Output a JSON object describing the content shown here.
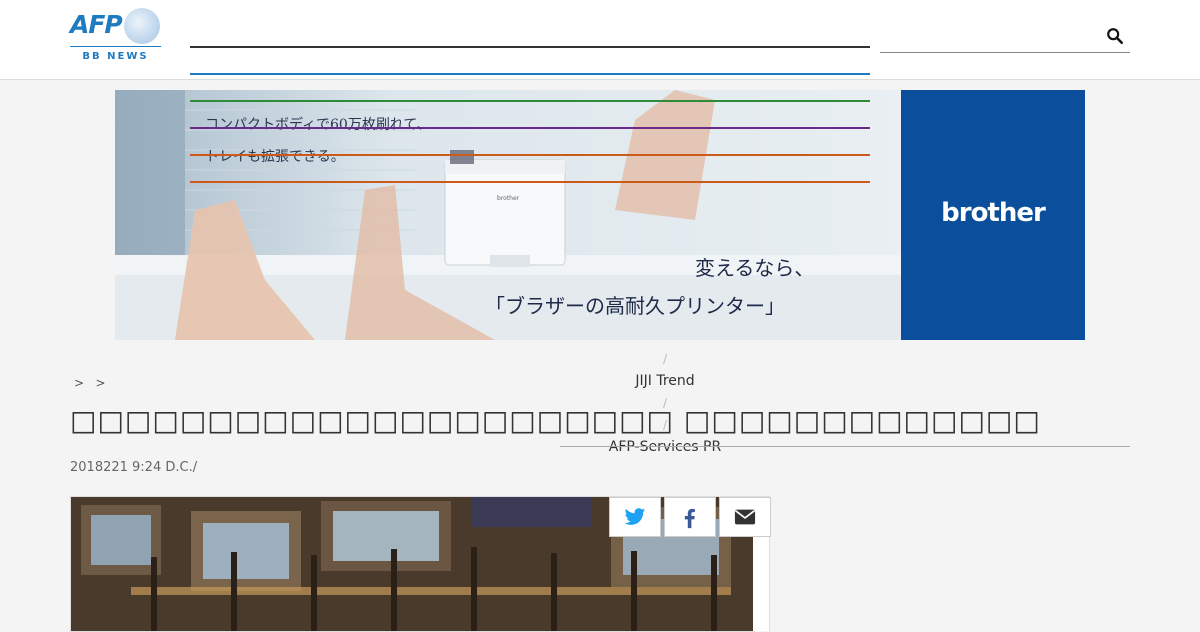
{
  "logo": {
    "brand": "AFP",
    "sub": "BB NEWS"
  },
  "search": {
    "placeholder": ""
  },
  "banner": {
    "copy_line_1": "コンパクトボディで60万枚刷れて、",
    "copy_line_2": "トレイも拡張できる。",
    "headline_1": "変えるなら、",
    "headline_2": "「ブラザーの高耐久プリンター」",
    "brand": "brother",
    "printer_label": "brother"
  },
  "breadcrumb": {
    "sep1": ">",
    "sep2": ">"
  },
  "nav": {
    "slash": "/",
    "item_1": "JIJI Trend",
    "item_2": "AFP-Services PR"
  },
  "article": {
    "title": "□□□□□□□□□□□□□□□□□□□□□□ □□□□□□□□□□□□□",
    "dateline": "2018221 9:24  D.C./"
  },
  "share": {
    "twitter": "twitter-icon",
    "facebook": "facebook-icon",
    "email": "email-icon"
  },
  "colors": {
    "brand_blue": "#1f7bc0",
    "brother_blue": "#0b4f9c",
    "nav_dark": "#333333",
    "nav_blue": "#1f7bc0",
    "line_green": "#2e8b3a",
    "line_purple": "#6a2a8c",
    "line_orange": "#cc5a1a",
    "twitter": "#1da1f2",
    "facebook": "#3b5998"
  }
}
